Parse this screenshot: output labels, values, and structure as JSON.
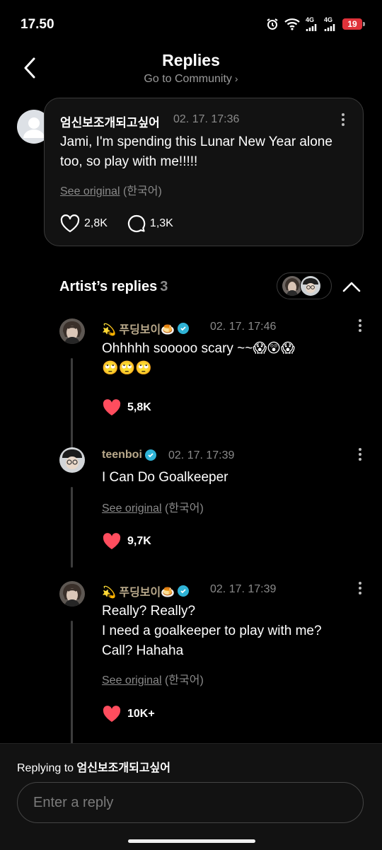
{
  "status_bar": {
    "time": "17.50",
    "battery": "19",
    "network_1": "4G",
    "network_2": "4G"
  },
  "header": {
    "title": "Replies",
    "subtitle": "Go to Community",
    "subtitle_chevron": "›"
  },
  "post": {
    "author": "엄신보조개되고싶어",
    "date": "02. 17. 17:36",
    "text": "Jami, I'm spending this Lunar New Year alone too, so play with me!!!!!",
    "see_original": "See original",
    "language": "(한국어)",
    "likes": "2,8K",
    "comments": "1,3K"
  },
  "artist_replies": {
    "label": "Artist’s replies",
    "count": "3",
    "replies": [
      {
        "name": "💫 푸딩보이🍮",
        "date": "02. 17. 17:46",
        "text": "Ohhhhh sooooo scary ~~😱😲😱",
        "text2": "🙄🙄🙄",
        "likes": "5,8K"
      },
      {
        "name": "teenboi",
        "date": "02. 17. 17:39",
        "text": "I Can Do Goalkeeper",
        "see_original": "See original",
        "language": "(한국어)",
        "likes": "9,7K"
      },
      {
        "name": "💫 푸딩보이🍮",
        "date": "02. 17. 17:39",
        "text_lines": [
          "Really? Really?",
          "I need a goalkeeper to play with me?",
          "Call? Hahaha"
        ],
        "see_original": "See original",
        "language": "(한국어)",
        "likes": "10K+"
      }
    ]
  },
  "composer": {
    "replying_prefix": "Replying to",
    "replying_to": "엄신보조개되고싶어",
    "placeholder": "Enter a reply"
  },
  "colors": {
    "background": "#000000",
    "card": "#121212",
    "artist_name": "#b9a98b",
    "like_heart": "#ff4d5e",
    "verified": "#2fb3d6"
  }
}
